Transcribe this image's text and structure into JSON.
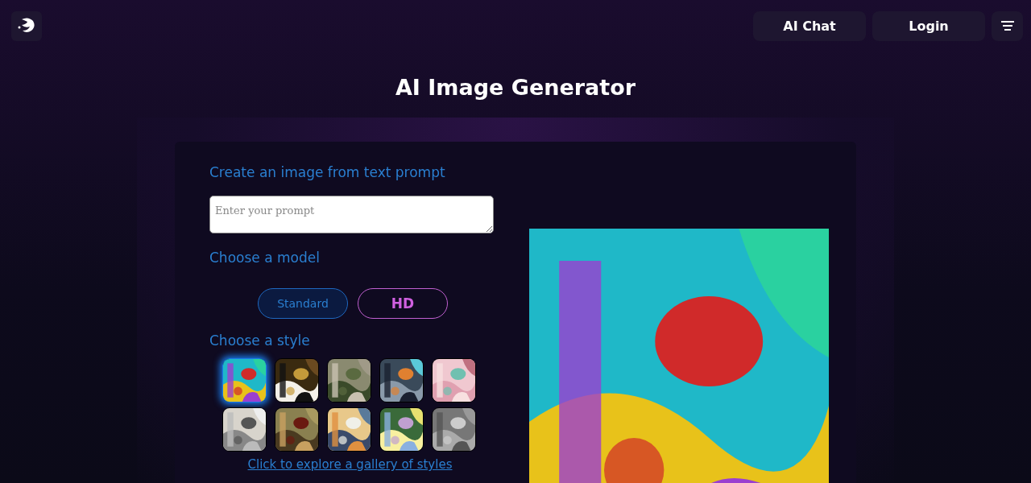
{
  "header": {
    "buttons": [
      {
        "label": "AI Chat"
      },
      {
        "label": "Login"
      }
    ]
  },
  "title": "AI Image Generator",
  "generator": {
    "prompt_heading": "Create an image from text prompt",
    "prompt": {
      "placeholder": "Enter your prompt"
    },
    "model_heading": "Choose a model",
    "models": [
      {
        "label": "Standard",
        "selected": true
      },
      {
        "label": "HD",
        "selected": false
      }
    ],
    "style_heading": "Choose a style",
    "styles": [
      {
        "kind": "picture",
        "selected": true
      },
      {
        "kind": "picture",
        "selected": false
      },
      {
        "kind": "picture",
        "selected": false
      },
      {
        "kind": "picture",
        "selected": false
      },
      {
        "kind": "picture",
        "selected": false
      },
      {
        "kind": "picture",
        "selected": false
      },
      {
        "kind": "picture",
        "selected": false
      },
      {
        "kind": "picture",
        "selected": false
      },
      {
        "kind": "picture",
        "selected": false
      },
      {
        "kind": "picture",
        "selected": false
      }
    ],
    "gallery_link": "Click to explore a gallery of styles",
    "preview": {
      "kind": "picture"
    }
  }
}
